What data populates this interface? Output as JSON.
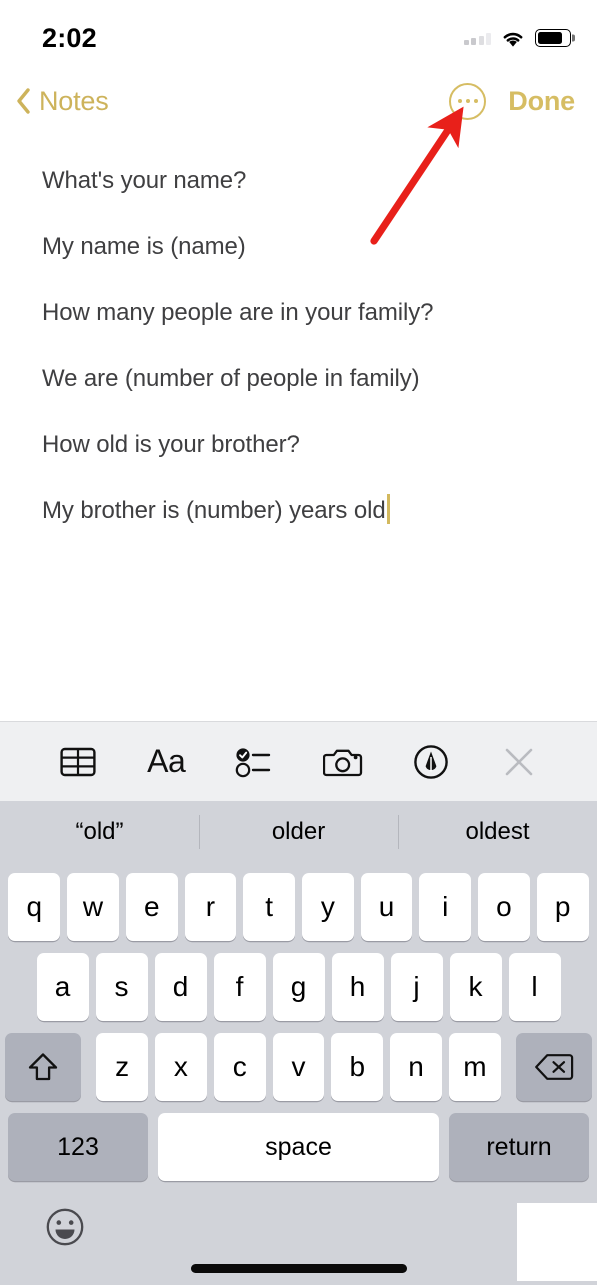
{
  "status_bar": {
    "time": "2:02",
    "signal_icon": "cellular-signal-icon",
    "wifi_icon": "wifi-icon",
    "battery_icon": "battery-icon",
    "battery_level_percent": 80
  },
  "nav_bar": {
    "back_label": "Notes",
    "back_icon": "chevron-left-icon",
    "more_icon": "more-ellipsis-circle-icon",
    "done_label": "Done"
  },
  "note": {
    "lines": [
      "What's your name?",
      "My name is (name)",
      "How many people are in your family?",
      "We are (number of people in family)",
      "How old is your brother?",
      "My brother is (number) years old"
    ],
    "caret_after_line_index": 5
  },
  "note_toolbar": {
    "items": [
      {
        "icon": "table-icon",
        "label": ""
      },
      {
        "icon": "format-aa-icon",
        "label": "Aa"
      },
      {
        "icon": "checklist-icon",
        "label": ""
      },
      {
        "icon": "camera-icon",
        "label": ""
      },
      {
        "icon": "markup-pen-icon",
        "label": ""
      },
      {
        "icon": "close-x-icon",
        "label": ""
      }
    ]
  },
  "predictive_bar": {
    "suggestions": [
      "“old”",
      "older",
      "oldest"
    ]
  },
  "keyboard": {
    "row1": [
      "q",
      "w",
      "e",
      "r",
      "t",
      "y",
      "u",
      "i",
      "o",
      "p"
    ],
    "row2": [
      "a",
      "s",
      "d",
      "f",
      "g",
      "h",
      "j",
      "k",
      "l"
    ],
    "row3": [
      "z",
      "x",
      "c",
      "v",
      "b",
      "n",
      "m"
    ],
    "shift_icon": "shift-arrow-icon",
    "backspace_icon": "backspace-delete-icon",
    "numbers_label": "123",
    "space_label": "space",
    "return_label": "return",
    "emoji_icon": "emoji-smiley-icon"
  },
  "colors": {
    "accent_gold": "#d6bd63",
    "note_text": "#3f3f41",
    "keyboard_bg": "#d1d3d9",
    "key_white": "#ffffff",
    "key_grey": "#aeb1bb",
    "toolbar_bg": "#eff0f2",
    "annotation_red": "#e8201a"
  },
  "annotation": {
    "type": "arrow-pointing-to-more-button",
    "target": "more-ellipsis-circle-icon"
  }
}
